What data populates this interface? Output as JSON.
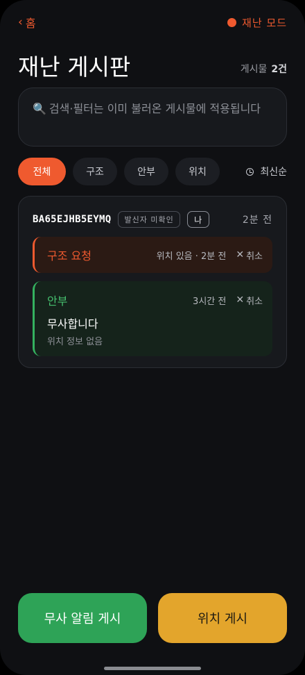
{
  "nav": {
    "back_chevron": "‹",
    "back_label": "홈",
    "mode_label": "재난 모드",
    "mode_color": "#ef5a2f"
  },
  "header": {
    "title": "재난 게시판",
    "count_label": "게시물",
    "count_value": "2건"
  },
  "search": {
    "icon": "search-icon",
    "glyph": "🔍",
    "text": "검색·필터는 이미 불러온 게시물에 적용됩니다"
  },
  "filters": {
    "chips": [
      "전체",
      "구조",
      "안부",
      "위치"
    ],
    "active_index": 0,
    "sort_label": "최신순"
  },
  "post": {
    "device_id": "BA65EJHB5EYMQ",
    "sender_badge": "발신자 미확인",
    "me_badge": "나",
    "age": "2분 전",
    "entries": [
      {
        "type": "구조 요청",
        "meta": "위치 있음 · 2분 전",
        "cancel": "취소",
        "cancel_glyph": "✕",
        "color": "#ef5a2f"
      },
      {
        "type": "안부",
        "meta": "3시간 전",
        "cancel": "취소",
        "cancel_glyph": "✕",
        "message": "무사합니다",
        "location": "위치 정보 없음",
        "color": "#34b15f"
      }
    ]
  },
  "actions": {
    "safe_button": "무사 알림 게시",
    "location_button": "위치 게시",
    "safe_color": "#2ea357",
    "location_color": "#e3a52c"
  }
}
